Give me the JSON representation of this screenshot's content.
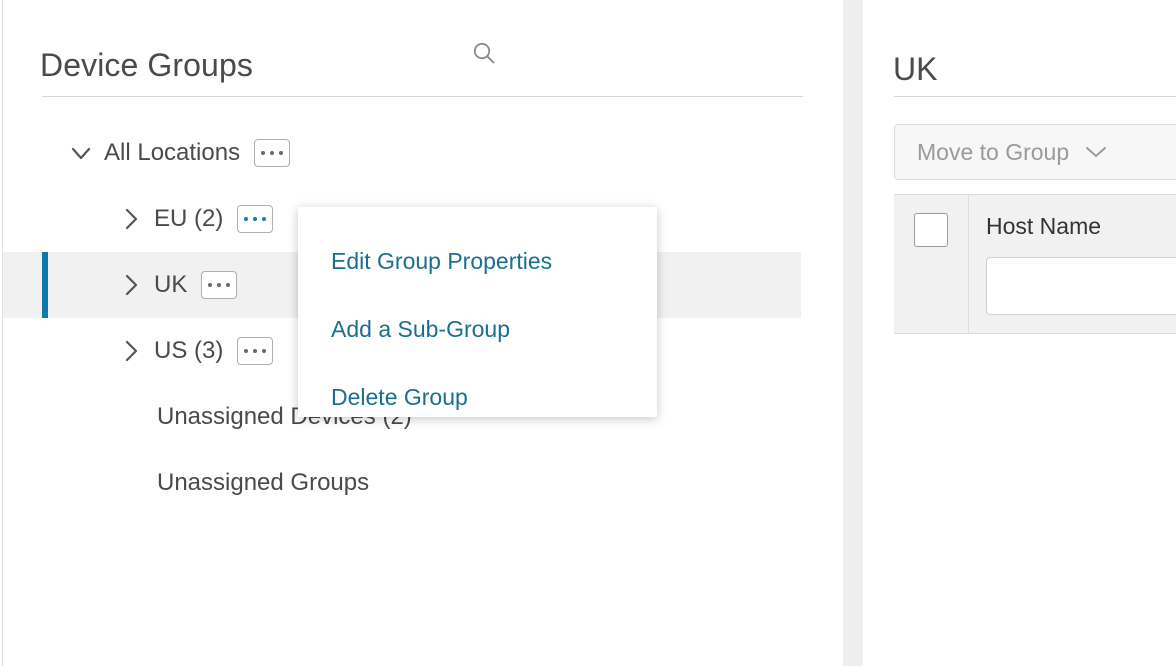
{
  "left_panel": {
    "title": "Device Groups",
    "search_icon": "search-icon",
    "tree": [
      {
        "label": "All Locations",
        "level": 0,
        "twisty": "chevron-down-icon",
        "has_twisty": true,
        "has_menu": true,
        "menu_accent": false,
        "selected": false
      },
      {
        "label": "EU (2)",
        "level": 1,
        "twisty": "chevron-right-icon",
        "has_twisty": true,
        "has_menu": true,
        "menu_accent": true,
        "selected": false
      },
      {
        "label": "UK",
        "level": 1,
        "twisty": "chevron-right-icon",
        "has_twisty": true,
        "has_menu": true,
        "menu_accent": false,
        "selected": true
      },
      {
        "label": "US (3)",
        "level": 1,
        "twisty": "chevron-right-icon",
        "has_twisty": true,
        "has_menu": true,
        "menu_accent": false,
        "selected": false
      },
      {
        "label": "Unassigned Devices (2)",
        "level": 1,
        "twisty": "",
        "has_twisty": false,
        "has_menu": false,
        "menu_accent": false,
        "selected": false
      },
      {
        "label": "Unassigned Groups",
        "level": 1,
        "twisty": "",
        "has_twisty": false,
        "has_menu": false,
        "menu_accent": false,
        "selected": false
      }
    ]
  },
  "context_menu": {
    "visible": true,
    "items": [
      {
        "label": "Edit Group Properties",
        "name": "menu-item-edit-group-properties"
      },
      {
        "label": "Add a Sub-Group",
        "name": "menu-item-add-sub-group"
      },
      {
        "label": "Delete Group",
        "name": "menu-item-delete-group"
      }
    ]
  },
  "right_panel": {
    "title": "UK",
    "move_to_group_label": "Move to Group",
    "move_to_group_icon": "chevron-down-icon",
    "table": {
      "select_all_checked": false,
      "columns": [
        {
          "label": "Host Name",
          "filter_value": "",
          "filter_placeholder": ""
        }
      ],
      "rows": []
    }
  },
  "colors": {
    "accent_blue": "#0b7aab",
    "link_teal": "#1a6f8e",
    "selected_row_bg": "#f1f1f1",
    "gutter_bg": "#eeeeee",
    "text_gray": "#4a4a4a",
    "muted_gray": "#9a9a9a",
    "border_gray": "#dcdcdc"
  }
}
